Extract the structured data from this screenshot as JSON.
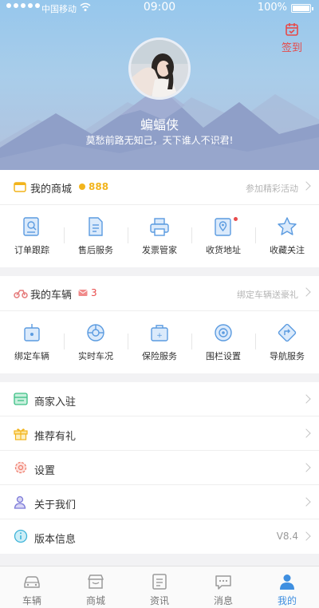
{
  "status_bar": {
    "carrier": "中国移动",
    "time": "09:00",
    "battery": "100%"
  },
  "header": {
    "signin_label": "签到",
    "username": "蝙蝠侠",
    "motto": "莫愁前路无知己，天下谁人不识君!"
  },
  "mall": {
    "title": "我的商城",
    "coins": "888",
    "more": "参加精彩活动",
    "items": [
      {
        "label": "订单跟踪",
        "icon": "order-tracking-icon"
      },
      {
        "label": "售后服务",
        "icon": "after-sales-icon"
      },
      {
        "label": "发票管家",
        "icon": "invoice-printer-icon"
      },
      {
        "label": "收货地址",
        "icon": "address-icon"
      },
      {
        "label": "收藏关注",
        "icon": "favorite-star-icon"
      }
    ]
  },
  "vehicle": {
    "title": "我的车辆",
    "messages": "3",
    "more": "绑定车辆送豪礼",
    "items": [
      {
        "label": "绑定车辆",
        "icon": "bind-vehicle-icon"
      },
      {
        "label": "实时车况",
        "icon": "vehicle-status-icon"
      },
      {
        "label": "保险服务",
        "icon": "insurance-icon"
      },
      {
        "label": "围栏设置",
        "icon": "geofence-icon"
      },
      {
        "label": "导航服务",
        "icon": "navigation-icon"
      }
    ]
  },
  "menu": [
    {
      "label": "商家入驻",
      "icon": "merchant-icon",
      "value": ""
    },
    {
      "label": "推荐有礼",
      "icon": "gift-icon",
      "value": ""
    },
    {
      "label": "设置",
      "icon": "settings-gear-icon",
      "value": ""
    },
    {
      "label": "关于我们",
      "icon": "about-us-icon",
      "value": ""
    },
    {
      "label": "版本信息",
      "icon": "version-info-icon",
      "value": "V8.4"
    }
  ],
  "tabs": [
    {
      "label": "车辆",
      "icon": "car-icon"
    },
    {
      "label": "商城",
      "icon": "store-icon"
    },
    {
      "label": "资讯",
      "icon": "news-icon"
    },
    {
      "label": "消息",
      "icon": "message-icon"
    },
    {
      "label": "我的",
      "icon": "profile-icon"
    }
  ],
  "colors": {
    "accent_blue": "#3f8fe0",
    "icon_blue": "#5b9be0",
    "coin_gold": "#f2b41c",
    "alert_red": "#e84b4b",
    "signin_red": "#e64a4a"
  }
}
